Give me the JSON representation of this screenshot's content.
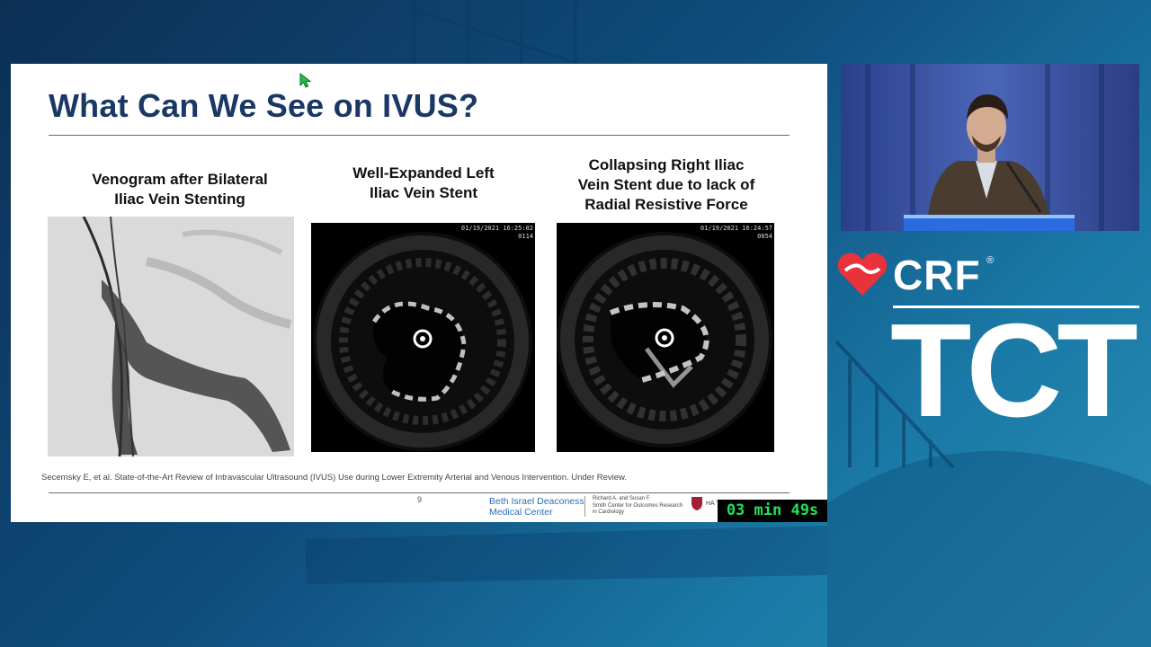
{
  "slide": {
    "title": "What Can We See on IVUS?",
    "panels": [
      {
        "caption_line1": "Venogram after Bilateral",
        "caption_line2": "Iliac Vein Stenting"
      },
      {
        "caption_line1": "Well-Expanded Left",
        "caption_line2": "Iliac Vein Stent",
        "timestamp": "01/19/2021 16:25:02",
        "frame": "0114"
      },
      {
        "caption_line1": "Collapsing Right Iliac",
        "caption_line2": "Vein Stent due to lack of",
        "caption_line3": "Radial Resistive Force",
        "timestamp": "01/19/2021 16:24:57",
        "frame": "0054"
      }
    ],
    "citation": "Secemsky E, et al. State-of-the-Art Review of Intravascular Ultrasound (IVUS) Use during Lower Extremity Arterial and Venous Intervention. Under Review.",
    "page_number": "9",
    "footer": {
      "bidmc_line1": "Beth Israel Deaconess",
      "bidmc_line2": "Medical Center",
      "smith_line1": "Richard A. and Susan F.",
      "smith_line2": "Smith Center for Outcomes Research",
      "smith_line3": "in Cardiology",
      "harvard_text": "HA TEA"
    }
  },
  "timer": "03 min 49s",
  "branding": {
    "crf": "CRF",
    "registered": "®",
    "tct": "TCT",
    "heart_color": "#e8323c"
  },
  "colors": {
    "title": "#1a3866",
    "timer_text": "#22e05a",
    "background": "#0f4d7c"
  }
}
